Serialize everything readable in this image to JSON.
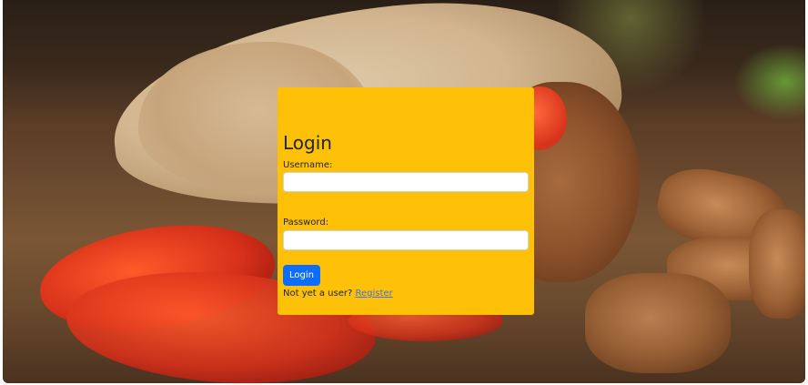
{
  "login": {
    "title": "Login",
    "username_label": "Username:",
    "username_value": "",
    "password_label": "Password:",
    "password_value": "",
    "submit_label": "Login",
    "register_prompt": "Not yet a user?",
    "register_link": "Register"
  },
  "colors": {
    "card_background": "#ffc107",
    "button_background": "#0d6efd",
    "link_color": "#4a6fd6"
  }
}
